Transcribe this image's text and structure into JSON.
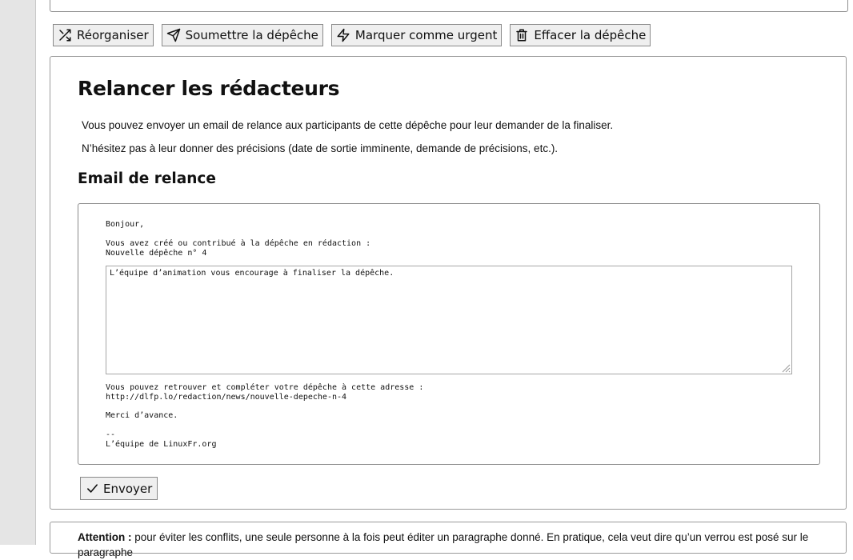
{
  "toolbar": {
    "buttons": [
      {
        "label": "Réorganiser",
        "icon": "shuffle-icon"
      },
      {
        "label": "Soumettre la dépêche",
        "icon": "send-icon"
      },
      {
        "label": "Marquer comme urgent",
        "icon": "lightning-icon"
      },
      {
        "label": "Effacer la dépêche",
        "icon": "trash-icon"
      }
    ]
  },
  "reminder": {
    "title": "Relancer les rédacteurs",
    "intro": "Vous pouvez envoyer un email de relance aux participants de cette dépêche pour leur demander de la finaliser.",
    "hint": "N’hésitez pas à leur donner des précisions (date de sortie imminente, demande de précisions, etc.).",
    "email_heading": "Email de relance",
    "email_greeting": "Bonjour,",
    "email_line1": "Vous avez créé ou contribué à la dépêche en rédaction :",
    "email_news_title": "Nouvelle dépêche n° 4",
    "message_value": "L’équipe d’animation vous encourage à finaliser la dépêche.",
    "email_line2": "Vous pouvez retrouver et compléter votre dépêche à cette adresse :",
    "email_url": "http://dlfp.lo/redaction/news/nouvelle-depeche-n-4",
    "email_thanks": "Merci d’avance.",
    "email_sig_sep": "--",
    "email_signature": "L’équipe de LinuxFr.org",
    "send_label": "Envoyer"
  },
  "notice": {
    "label": "Attention :",
    "text": "pour éviter les conflits, une seule personne à la fois peut éditer un paragraphe donné. En pratique, cela veut dire qu’un verrou est posé sur le paragraphe"
  }
}
